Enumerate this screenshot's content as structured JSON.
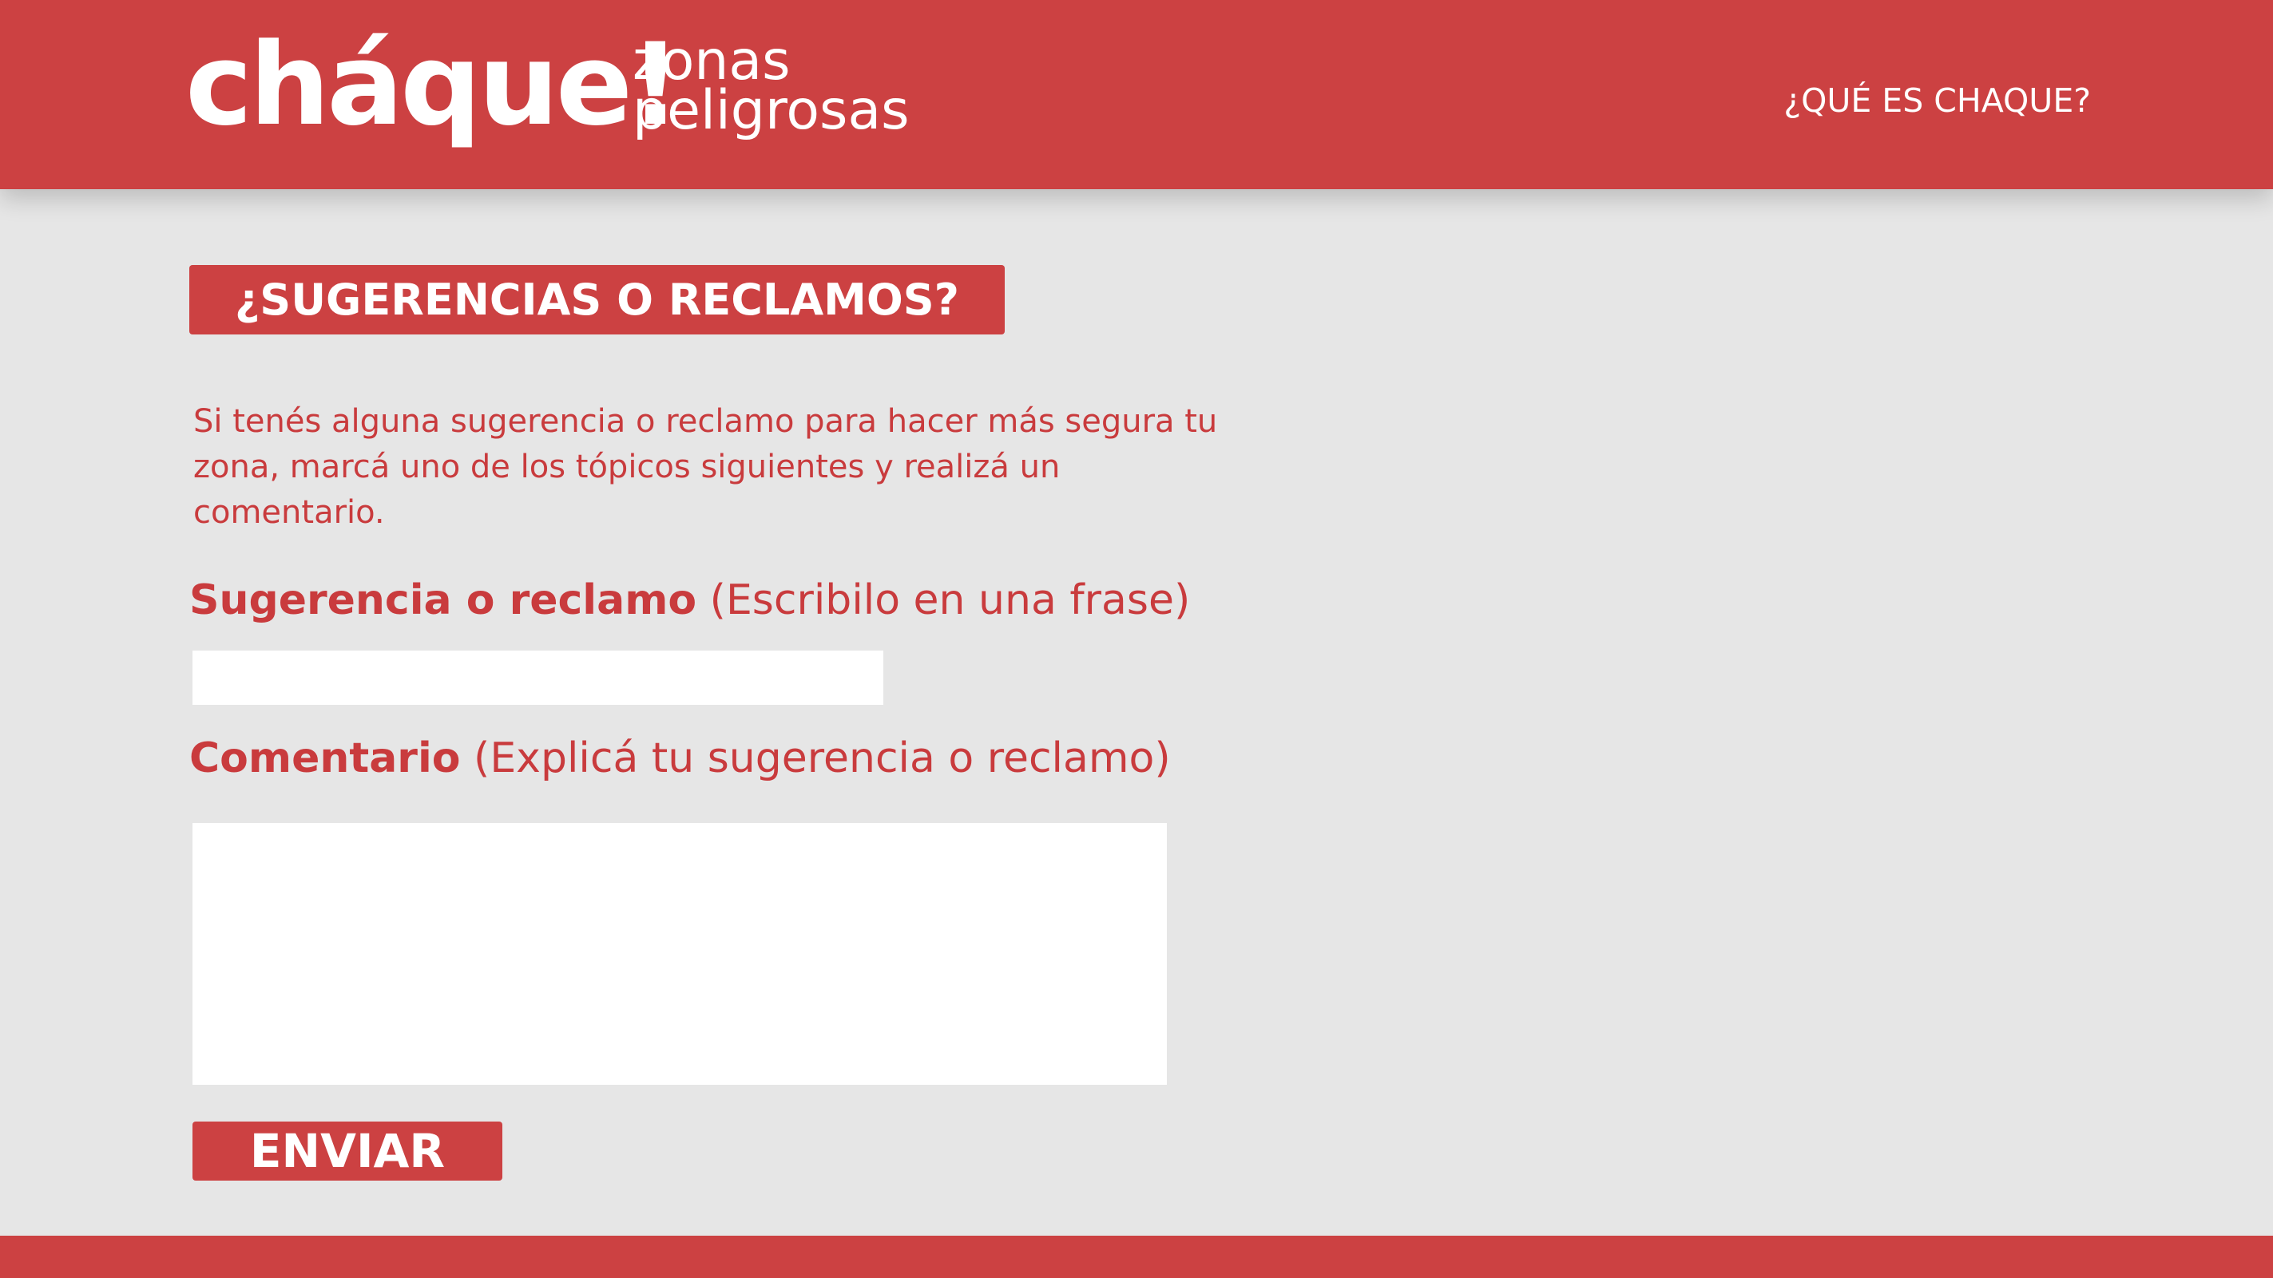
{
  "header": {
    "logo_main": "cháque!",
    "logo_sub_line1": "zonas",
    "logo_sub_line2": "peligrosas",
    "nav_link": "¿QUÉ ES CHAQUE?"
  },
  "form": {
    "title": "¿SUGERENCIAS O RECLAMOS?",
    "description": "Si tenés alguna sugerencia o reclamo para hacer más segura tu zona, marcá uno de los tópicos siguientes y realizá un comentario.",
    "field1": {
      "label_strong": "Sugerencia o reclamo",
      "label_hint": " (Escribilo en una frase)",
      "value": "",
      "placeholder": ""
    },
    "field2": {
      "label_strong": "Comentario",
      "label_hint": " (Explicá tu sugerencia o reclamo)",
      "value": "",
      "placeholder": ""
    },
    "submit_label": "ENVIAR"
  },
  "colors": {
    "brand_red": "#cc4142",
    "text_red": "#c93b3d",
    "background": "#e6e6e6",
    "field_background": "#ffffff"
  }
}
